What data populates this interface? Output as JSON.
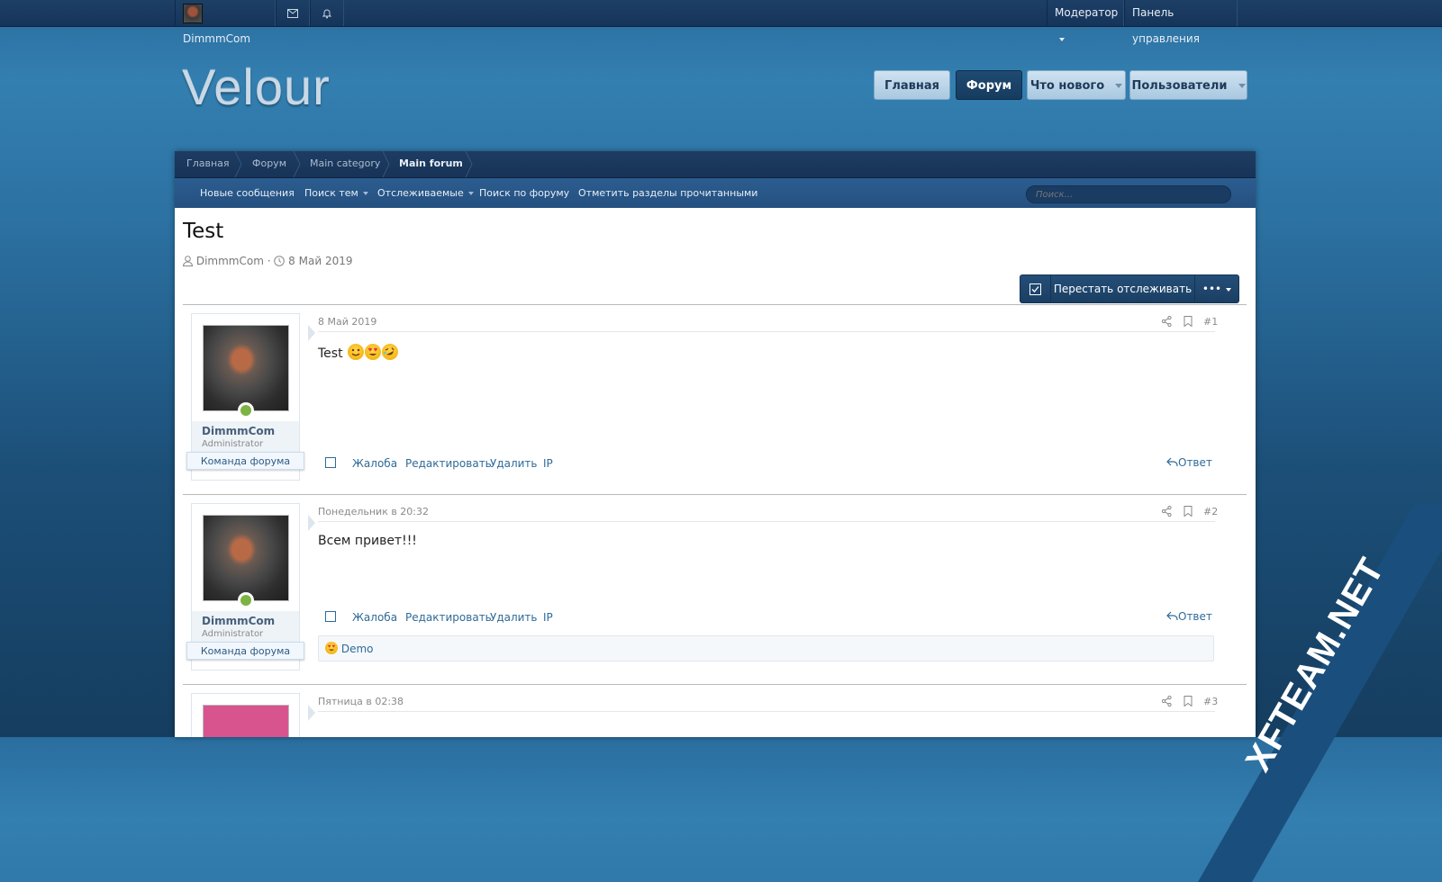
{
  "topbar": {
    "username": "DimmmCom",
    "moderator": "Модератор",
    "admin_panel": "Панель управления"
  },
  "logo": "Velour",
  "nav": [
    {
      "label": "Главная"
    },
    {
      "label": "Форум"
    },
    {
      "label": "Что нового"
    },
    {
      "label": "Пользователи"
    }
  ],
  "breadcrumbs": [
    "Главная",
    "Форум",
    "Main category",
    "Main forum"
  ],
  "subnav": {
    "items": [
      "Новые сообщения",
      "Поиск тем",
      "Отслеживаемые",
      "Поиск по форуму",
      "Отметить разделы прочитанными"
    ],
    "search_placeholder": "Поиск..."
  },
  "thread": {
    "title": "Test",
    "author": "DimmmCom",
    "date": "8 Май 2019",
    "unwatch_label": "Перестать отслеживать",
    "more_label": "•••"
  },
  "posts": [
    {
      "username": "DimmmCom",
      "user_title": "Administrator",
      "banner": "Команда форума",
      "date": "8 Май 2019",
      "number": "#1",
      "body": "Test",
      "emojis": [
        "slightly-smiling-face",
        "heart-eyes-face",
        "rolling-laughing-face"
      ]
    },
    {
      "username": "DimmmCom",
      "user_title": "Administrator",
      "banner": "Команда форума",
      "date": "Понедельник в 20:32",
      "number": "#2",
      "body": "Всем привет!!!",
      "reaction": {
        "icon": "heart-eyes-face",
        "user": "Demo"
      }
    },
    {
      "date": "Пятница в 02:38",
      "number": "#3"
    }
  ],
  "actions": {
    "report": "Жалоба",
    "edit": "Редактировать",
    "delete": "Удалить",
    "ip": "IP",
    "reply": "Ответ"
  },
  "watermark": "XFTEAM.NET",
  "colors": {
    "accent": "#2e6a98",
    "header_dark": "#173357",
    "watermark_bg": "#1a4e7c"
  }
}
